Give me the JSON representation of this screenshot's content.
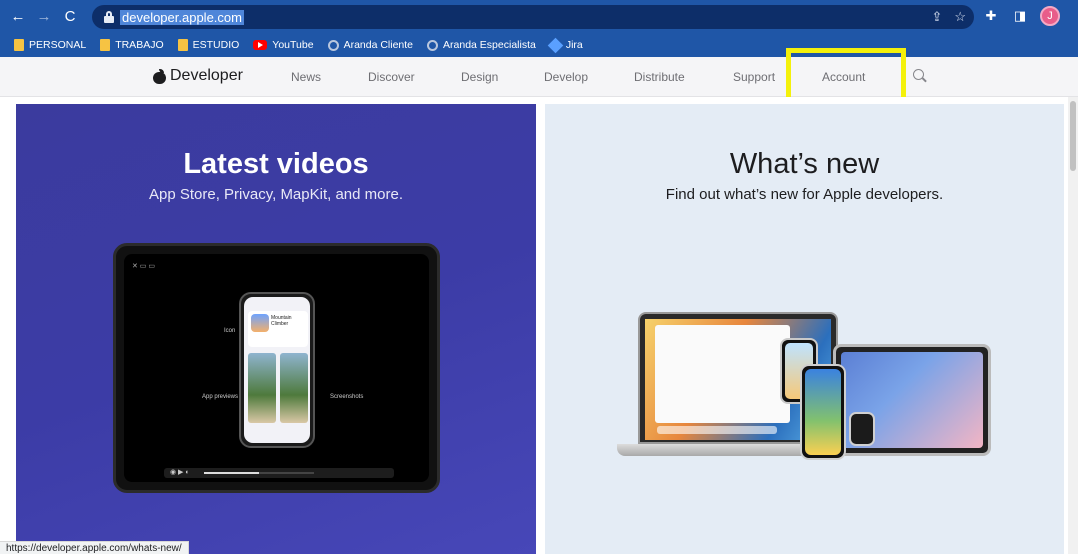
{
  "browser": {
    "url": "developer.apple.com",
    "profile_initial": "J",
    "status_url": "https://developer.apple.com/whats-new/"
  },
  "bookmarks": [
    {
      "label": "PERSONAL",
      "icon": "folder-icon"
    },
    {
      "label": "TRABAJO",
      "icon": "folder-icon"
    },
    {
      "label": "ESTUDIO",
      "icon": "folder-icon"
    },
    {
      "label": "YouTube",
      "icon": "youtube-icon"
    },
    {
      "label": "Aranda Cliente",
      "icon": "aranda-icon"
    },
    {
      "label": "Aranda Especialista",
      "icon": "aranda-icon"
    },
    {
      "label": "Jira",
      "icon": "jira-icon"
    }
  ],
  "devnav": {
    "brand": "Developer",
    "items": [
      "News",
      "Discover",
      "Design",
      "Develop",
      "Distribute",
      "Support",
      "Account"
    ]
  },
  "tiles": {
    "left": {
      "title": "Latest videos",
      "subtitle": "App Store, Privacy, MapKit, and more."
    },
    "right": {
      "title": "What’s new",
      "subtitle": "Find out what’s new for Apple developers."
    }
  },
  "mockup": {
    "labels": {
      "appname": "Mountain Climber",
      "left": "App previews",
      "right": "Screenshots",
      "top": "Icon"
    }
  },
  "colors": {
    "chrome_blue": "#1f56a7",
    "highlight_box": "#f4f10b",
    "left_tile": "#3c3ca6",
    "right_tile": "#e4ecf5"
  }
}
